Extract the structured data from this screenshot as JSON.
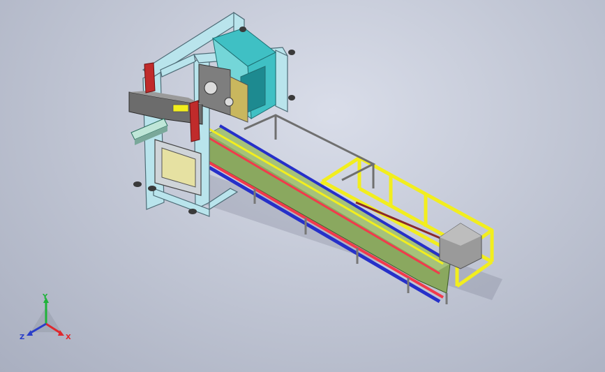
{
  "viewport": {
    "background_top": "#d9dde9",
    "background_bottom": "#a9afc0"
  },
  "triad": {
    "x_label": "X",
    "y_label": "Y",
    "z_label": "Z",
    "x_color": "#e0282d",
    "y_color": "#1fb33a",
    "z_color": "#2a3ec9"
  },
  "model": {
    "frame_color": "#b9e4ec",
    "guard_color": "#3fc0c4",
    "conveyor_green": "#8aa85f",
    "rail_red": "#f23a4c",
    "rail_blue": "#2630c9",
    "support_yellow": "#f2ee1e",
    "housing_gray": "#8a8a8a"
  }
}
